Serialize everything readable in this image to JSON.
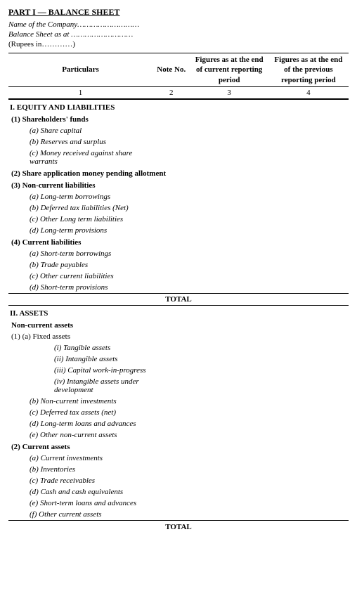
{
  "title": "PART I — BALANCE SHEET",
  "company_name_label": "Name of the Company………………………",
  "balance_sheet_label": "Balance Sheet as at ………………………",
  "rupees_label": "(Rupees in…………)",
  "columns": {
    "particulars": "Particulars",
    "note_no": "Note No.",
    "current": "Figures as at the end of current reporting period",
    "previous": "Figures as at the end of the previous reporting period"
  },
  "col_numbers": [
    "1",
    "2",
    "3",
    "4"
  ],
  "sections": [
    {
      "type": "section-header",
      "text": "I. EQUITY AND LIABILITIES"
    },
    {
      "type": "subsection-header",
      "text": "(1) Shareholders' funds"
    },
    {
      "type": "item-italic",
      "text": "(a) Share capital",
      "indent": 1
    },
    {
      "type": "item-italic",
      "text": "(b) Reserves and surplus",
      "indent": 1
    },
    {
      "type": "item-italic-wrap",
      "text": "(c) Money received against share warrants",
      "indent": 1
    },
    {
      "type": "subsection-header-wrap",
      "text": "(2) Share application money pending allotment"
    },
    {
      "type": "subsection-header",
      "text": "(3) Non-current liabilities"
    },
    {
      "type": "item-italic",
      "text": "(a) Long-term borrowings",
      "indent": 1
    },
    {
      "type": "item-italic",
      "text": "(b) Deferred tax liabilities (Net)",
      "indent": 1
    },
    {
      "type": "item-italic",
      "text": "(c) Other Long term liabilities",
      "indent": 1
    },
    {
      "type": "item-italic",
      "text": "(d) Long-term provisions",
      "indent": 1
    },
    {
      "type": "subsection-header",
      "text": "(4) Current liabilities"
    },
    {
      "type": "item-italic",
      "text": "(a) Short-term borrowings",
      "indent": 1
    },
    {
      "type": "item-italic",
      "text": "(b) Trade payables",
      "indent": 1
    },
    {
      "type": "item-italic",
      "text": "(c) Other current liabilities",
      "indent": 1
    },
    {
      "type": "item-italic",
      "text": "(d) Short-term provisions",
      "indent": 1
    },
    {
      "type": "total",
      "text": "TOTAL"
    },
    {
      "type": "section-header",
      "text": "II. ASSETS"
    },
    {
      "type": "subsection-header",
      "text": "Non-current assets"
    },
    {
      "type": "fixed-assets-row",
      "text": "(1)       (a) Fixed assets"
    },
    {
      "type": "item-italic",
      "text": "(i) Tangible assets",
      "indent": 2
    },
    {
      "type": "item-italic",
      "text": "(ii) Intangible assets",
      "indent": 2
    },
    {
      "type": "item-italic",
      "text": "(iii) Capital work-in-progress",
      "indent": 2
    },
    {
      "type": "item-italic-wrap2",
      "text": "(iv) Intangible assets under development",
      "indent": 2
    },
    {
      "type": "item-italic",
      "text": "(b) Non-current investments",
      "indent": 1
    },
    {
      "type": "item-italic",
      "text": "(c) Deferred tax assets (net)",
      "indent": 1
    },
    {
      "type": "item-italic",
      "text": "(d) Long-term loans and advances",
      "indent": 1
    },
    {
      "type": "item-italic",
      "text": "(e) Other non-current assets",
      "indent": 1
    },
    {
      "type": "subsection-header",
      "text": "(2) Current assets"
    },
    {
      "type": "item-italic",
      "text": "(a) Current investments",
      "indent": 1
    },
    {
      "type": "item-italic",
      "text": "(b) Inventories",
      "indent": 1
    },
    {
      "type": "item-italic",
      "text": "(c) Trade receivables",
      "indent": 1
    },
    {
      "type": "item-italic",
      "text": "(d) Cash and cash equivalents",
      "indent": 1
    },
    {
      "type": "item-italic",
      "text": "(e) Short-term loans and advances",
      "indent": 1
    },
    {
      "type": "item-italic",
      "text": "(f) Other current assets",
      "indent": 1
    }
  ],
  "total_label": "TOTAL"
}
